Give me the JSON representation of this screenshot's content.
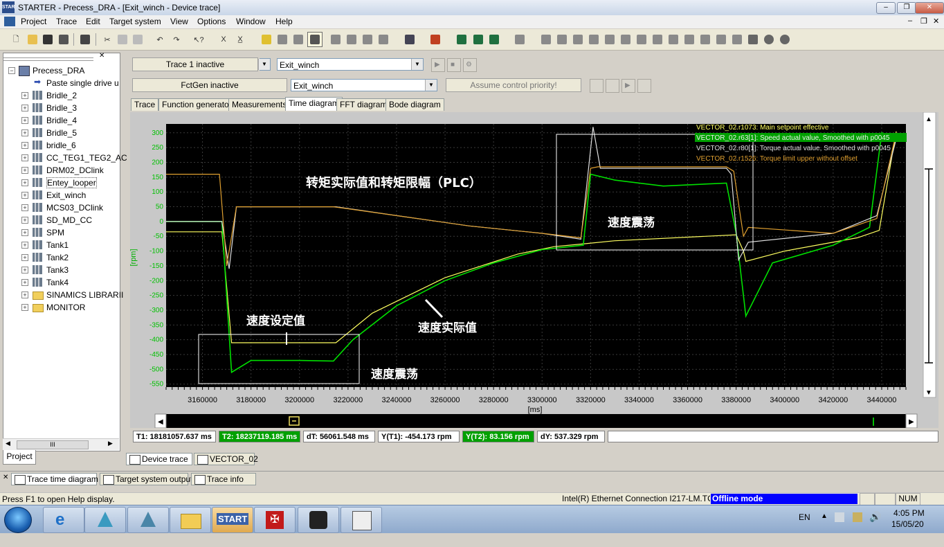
{
  "window": {
    "title": "STARTER - Precess_DRA - [Exit_winch - Device trace]",
    "app_icon_text": "STAR"
  },
  "menu": [
    "Project",
    "Trace",
    "Edit",
    "Target system",
    "View",
    "Options",
    "Window",
    "Help"
  ],
  "tree": {
    "root": "Precess_DRA",
    "items": [
      "Paste single drive u",
      "Bridle_2",
      "Bridle_3",
      "Bridle_4",
      "Bridle_5",
      "bridle_6",
      "CC_TEG1_TEG2_AC",
      "DRM02_DClink",
      "Entey_looper",
      "Exit_winch",
      "MCS03_DClink",
      "SD_MD_CC",
      "SPM",
      "Tank1",
      "Tank2",
      "Tank3",
      "Tank4",
      "SINAMICS LIBRARII",
      "MONITOR"
    ],
    "scroll_label": "III",
    "tab": "Project"
  },
  "trace": {
    "trace_status": "Trace 1 inactive",
    "trace_object": "Exit_winch",
    "fctgen_status": "FctGen  inactive",
    "fctgen_object": "Exit_winch",
    "assume_control": "Assume control priority!"
  },
  "tabs": [
    "Trace",
    "Function generator",
    "Measurements",
    "Time diagram",
    "FFT diagram",
    "Bode diagram"
  ],
  "chart_data": {
    "type": "line",
    "xlabel": "[ms]",
    "ylabel": "[rpm]",
    "xlim": [
      3145000,
      3450000
    ],
    "ylim": [
      -560,
      330
    ],
    "x_ticks": [
      "3160000",
      "3180000",
      "3200000",
      "3220000",
      "3240000",
      "3260000",
      "3280000",
      "3300000",
      "3320000",
      "3340000",
      "3360000",
      "3380000",
      "3400000",
      "3420000",
      "3440000"
    ],
    "y_ticks": [
      "300",
      "250",
      "200",
      "150",
      "100",
      "50",
      "0",
      "-50",
      "-100",
      "-150",
      "-200",
      "-250",
      "-300",
      "-350",
      "-400",
      "-450",
      "-500",
      "-550"
    ],
    "grid": true,
    "legend": "top-right",
    "series": [
      {
        "name": "VECTOR_02.r1073: Main setpoint effective",
        "color": "#ffff60",
        "x": [
          3145000,
          3168000,
          3172000,
          3215000,
          3230000,
          3260000,
          3290000,
          3305000,
          3318000,
          3330000,
          3380000,
          3383000,
          3384000,
          3400000,
          3430000,
          3439000,
          3446000
        ],
        "y": [
          -35,
          -35,
          -410,
          -410,
          -310,
          -190,
          -110,
          -85,
          -75,
          -65,
          -45,
          -100,
          -135,
          -100,
          -55,
          -30,
          305
        ]
      },
      {
        "name": "VECTOR_02.r63[1]: Speed actual value, Smoothed with p0045",
        "color": "#00e000",
        "x": [
          3145000,
          3168000,
          3172000,
          3180000,
          3200000,
          3214000,
          3222000,
          3240000,
          3260000,
          3280000,
          3300000,
          3317000,
          3320000,
          3330000,
          3350000,
          3376000,
          3380000,
          3384000,
          3395000,
          3420000,
          3435000,
          3440000,
          3446000
        ],
        "y": [
          0,
          0,
          -510,
          -470,
          -470,
          -472,
          -400,
          -285,
          -200,
          -140,
          -95,
          -80,
          160,
          140,
          120,
          130,
          -40,
          -320,
          -140,
          -80,
          -20,
          300,
          280
        ]
      },
      {
        "name": "VECTOR_02.r80[1]: Torque actual value, Smoothed with p0045",
        "color": "#e0e0e0",
        "x": [
          3145000,
          3168000,
          3171000,
          3174000,
          3200000,
          3215000,
          3240000,
          3270000,
          3300000,
          3316000,
          3321000,
          3324000,
          3347000,
          3376000,
          3378000,
          3381000,
          3385000,
          3420000,
          3438000,
          3446000
        ],
        "y": [
          0,
          0,
          -160,
          50,
          50,
          50,
          20,
          -15,
          -40,
          -60,
          320,
          180,
          180,
          180,
          160,
          -130,
          -70,
          -40,
          20,
          280
        ]
      },
      {
        "name": "VECTOR_02.r1526: Torque limit upper without offset",
        "color": "#e0a030",
        "x": [
          3145000,
          3167000,
          3170000,
          3174000,
          3200000,
          3214000,
          3240000,
          3270000,
          3300000,
          3316000,
          3320000,
          3323000,
          3376000,
          3379000,
          3383000,
          3385000,
          3420000,
          3438000,
          3446000
        ],
        "y": [
          160,
          160,
          -150,
          50,
          50,
          50,
          20,
          -15,
          -40,
          -55,
          180,
          185,
          185,
          170,
          -50,
          -20,
          -40,
          10,
          300
        ]
      }
    ],
    "annotations": [
      "转矩实际值和转矩限幅（PLC）",
      "速度震荡",
      "速度设定值",
      "速度实际值",
      "速度震荡"
    ]
  },
  "cursor_status": {
    "t1": "T1: 18181057.637 ms",
    "t2": "T2: 18237119.185 ms",
    "dt": "dT: 56061.548 ms",
    "yt1": "Y(T1):  -454.173 rpm",
    "yt2": "Y(T2): 83.156 rpm",
    "dy": "dY: 537.329 rpm"
  },
  "doc_tabs": [
    "Device trace",
    "VECTOR_02"
  ],
  "bottom_tabs": [
    "Trace time diagram",
    "Target system output",
    "Trace info"
  ],
  "statusbar": {
    "help": "Press F1 to open Help display.",
    "connection": "Intel(R) Ethernet Connection I217-LM.TC",
    "mode": "Offline mode",
    "num": "NUM"
  },
  "taskbar": {
    "start_label": "START",
    "lang": "EN",
    "time": "4:05 PM",
    "date": "15/05/20"
  },
  "colors": {
    "plot_bg": "#000000",
    "grid": "#3a3a3a",
    "accent_green": "#00a000",
    "mode_blue": "#0000ff"
  }
}
